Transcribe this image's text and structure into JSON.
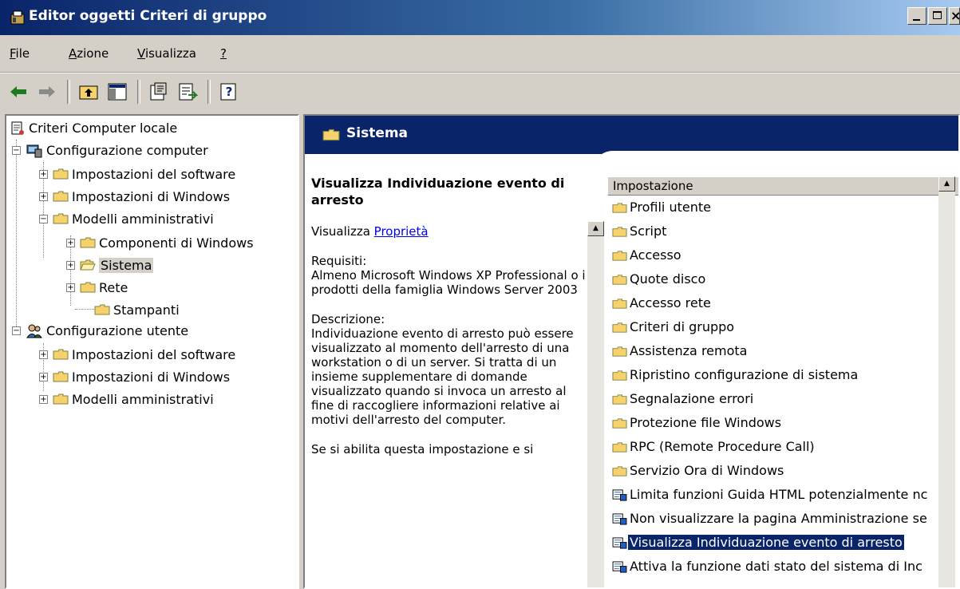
{
  "window": {
    "title": "Editor oggetti Criteri di gruppo"
  },
  "menu": [
    {
      "pre": "",
      "u": "F",
      "post": "ile"
    },
    {
      "pre": "",
      "u": "A",
      "post": "zione"
    },
    {
      "pre": "",
      "u": "V",
      "post": "isualizza"
    },
    {
      "pre": "",
      "u": "?",
      "post": ""
    }
  ],
  "tree": {
    "root": "Criteri Computer locale",
    "computer": "Configurazione computer",
    "c_software": "Impostazioni del software",
    "c_windows": "Impostazioni di Windows",
    "c_admin": "Modelli amministrativi",
    "c_components": "Componenti di Windows",
    "c_system": "Sistema",
    "c_network": "Rete",
    "c_printers": "Stampanti",
    "user": "Configurazione utente",
    "u_software": "Impostazioni del software",
    "u_windows": "Impostazioni di Windows",
    "u_admin": "Modelli amministrativi"
  },
  "right": {
    "header": "Sistema",
    "desc_title": "Visualizza Individuazione evento di arresto",
    "show_prefix": "Visualizza ",
    "show_link": "Proprietà",
    "req_label": "Requisiti:",
    "req_text": "Almeno Microsoft Windows XP Professional o i prodotti della famiglia Windows Server 2003",
    "desc_label": "Descrizione:",
    "desc_text": "Individuazione evento di arresto può essere visualizzato al momento dell'arresto di una workstation o di un server.  Si tratta di un insieme supplementare di domande visualizzato quando si invoca un arresto al fine di raccogliere informazioni relative ai motivi dell'arresto del computer.",
    "desc_more": "Se si abilita questa impostazione e si"
  },
  "list": {
    "column": "Impostazione",
    "items": [
      "Profili utente",
      "Script",
      "Accesso",
      "Quote disco",
      "Accesso rete",
      "Criteri di gruppo",
      "Assistenza remota",
      "Ripristino configurazione di sistema",
      "Segnalazione errori",
      "Protezione file Windows",
      "RPC (Remote Procedure Call)",
      "Servizio Ora di Windows",
      "Limita funzioni Guida HTML potenzialmente nc",
      "Non visualizzare la pagina Amministrazione se",
      "Visualizza Individuazione evento di arresto",
      "Attiva la funzione dati stato del sistema di Inc"
    ]
  }
}
